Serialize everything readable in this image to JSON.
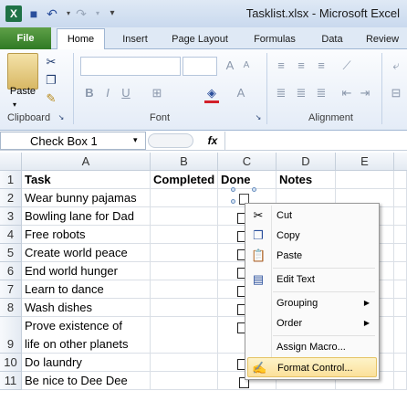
{
  "title": "Tasklist.xlsx - Microsoft Excel",
  "quick_access": {
    "undo": "↶",
    "redo": "↷",
    "customize": "▾"
  },
  "tabs": [
    "File",
    "Home",
    "Insert",
    "Page Layout",
    "Formulas",
    "Data",
    "Review"
  ],
  "ribbon": {
    "paste_label": "Paste",
    "clipboard_label": "Clipboard",
    "font_label": "Font",
    "alignment_label": "Alignment"
  },
  "name_box": "Check Box 1",
  "fx_label": "fx",
  "columns": [
    "A",
    "B",
    "C",
    "D",
    "E"
  ],
  "rows": [
    {
      "num": "1",
      "a": "Task",
      "b": "Completed",
      "c": "Done",
      "d": "Notes"
    },
    {
      "num": "2",
      "a": "Wear bunny pajamas",
      "b": "",
      "c": "",
      "d": ""
    },
    {
      "num": "3",
      "a": "Bowling lane for Dad",
      "b": "",
      "c": "",
      "d": ""
    },
    {
      "num": "4",
      "a": "Free robots",
      "b": "",
      "c": "",
      "d": ""
    },
    {
      "num": "5",
      "a": "Create world peace",
      "b": "",
      "c": "",
      "d": ""
    },
    {
      "num": "6",
      "a": "End world hunger",
      "b": "",
      "c": "",
      "d": ""
    },
    {
      "num": "7",
      "a": "Learn to dance",
      "b": "",
      "c": "",
      "d": ""
    },
    {
      "num": "8",
      "a": "Wash dishes",
      "b": "",
      "c": "",
      "d": ""
    },
    {
      "num": "9",
      "a": "Prove existence of",
      "a2": "life on other planets",
      "b": "",
      "c": "",
      "d": ""
    },
    {
      "num": "10",
      "a": "Do laundry",
      "b": "",
      "c": "",
      "d": ""
    },
    {
      "num": "11",
      "a": "Be nice to Dee Dee",
      "b": "",
      "c": "",
      "d": ""
    }
  ],
  "context_menu": [
    {
      "label": "Cut",
      "icon": "scissors-icon"
    },
    {
      "label": "Copy",
      "icon": "copy-icon"
    },
    {
      "label": "Paste",
      "icon": "paste-icon"
    },
    {
      "label": "Edit Text",
      "icon": "edit-text-icon"
    },
    {
      "label": "Grouping",
      "submenu": true
    },
    {
      "label": "Order",
      "submenu": true
    },
    {
      "label": "Assign Macro..."
    },
    {
      "label": "Format Control...",
      "icon": "format-control-icon",
      "highlighted": true
    }
  ],
  "colors": {
    "file_tab": "#2f7a24",
    "ribbon_bg": "#e4ecf7",
    "menu_highlight": "#fbe9a6"
  }
}
